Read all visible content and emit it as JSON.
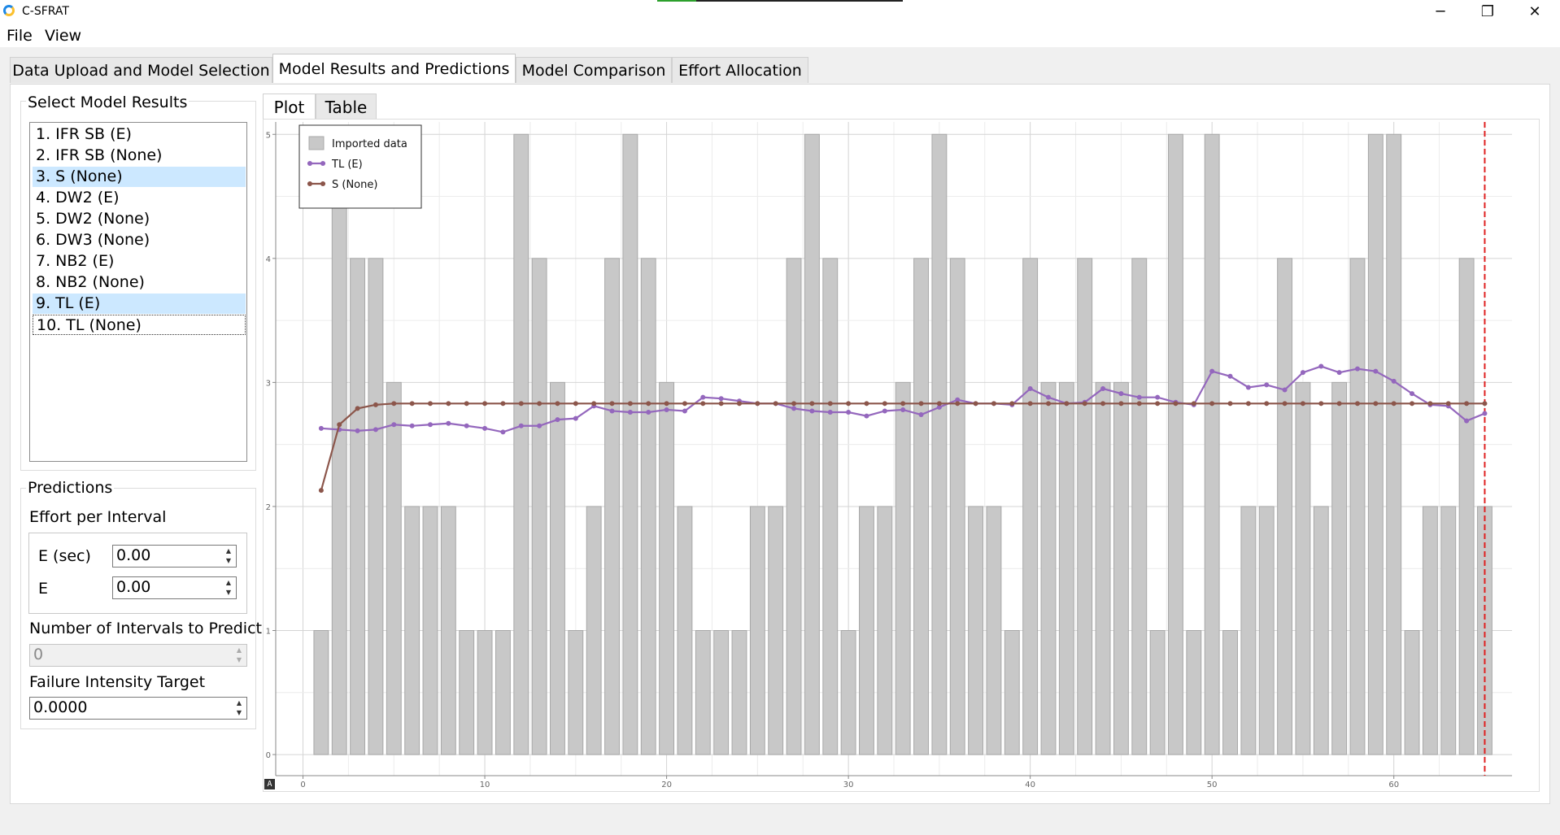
{
  "window": {
    "title": "C-SFRAT",
    "progress": 0.16,
    "controls": [
      "─",
      "❐",
      "✕"
    ]
  },
  "menu": [
    "File",
    "View"
  ],
  "main_tabs": [
    {
      "label": "Data Upload and Model Selection",
      "active": false
    },
    {
      "label": "Model Results and Predictions",
      "active": true
    },
    {
      "label": "Model Comparison",
      "active": false
    },
    {
      "label": "Effort Allocation",
      "active": false
    }
  ],
  "model_results": {
    "title": "Select Model Results",
    "items": [
      {
        "label": "1. IFR SB (E)",
        "selected": false,
        "focused": false
      },
      {
        "label": "2. IFR SB (None)",
        "selected": false,
        "focused": false
      },
      {
        "label": "3. S (None)",
        "selected": true,
        "focused": false
      },
      {
        "label": "4. DW2 (E)",
        "selected": false,
        "focused": false
      },
      {
        "label": "5. DW2 (None)",
        "selected": false,
        "focused": false
      },
      {
        "label": "6. DW3 (None)",
        "selected": false,
        "focused": false
      },
      {
        "label": "7. NB2 (E)",
        "selected": false,
        "focused": false
      },
      {
        "label": "8. NB2 (None)",
        "selected": false,
        "focused": false
      },
      {
        "label": "9. TL (E)",
        "selected": true,
        "focused": false
      },
      {
        "label": "10. TL (None)",
        "selected": false,
        "focused": true
      }
    ]
  },
  "predictions": {
    "title": "Predictions",
    "effort_label": "Effort per Interval",
    "effort_fields": [
      {
        "label": "E (sec)",
        "value": "0.00"
      },
      {
        "label": "E",
        "value": "0.00"
      }
    ],
    "intervals_label": "Number of Intervals to Predict",
    "intervals_value": "0",
    "target_label": "Failure Intensity Target",
    "target_value": "0.0000"
  },
  "plot_tabs": [
    {
      "label": "Plot",
      "active": true
    },
    {
      "label": "Table",
      "active": false
    }
  ],
  "chart_data": {
    "type": "bar",
    "x": [
      1,
      2,
      3,
      4,
      5,
      6,
      7,
      8,
      9,
      10,
      11,
      12,
      13,
      14,
      15,
      16,
      17,
      18,
      19,
      20,
      21,
      22,
      23,
      24,
      25,
      26,
      27,
      28,
      29,
      30,
      31,
      32,
      33,
      34,
      35,
      36,
      37,
      38,
      39,
      40,
      41,
      42,
      43,
      44,
      45,
      46,
      47,
      48,
      49,
      50,
      51,
      52,
      53,
      54,
      55,
      56,
      57,
      58,
      59,
      60,
      61,
      62,
      63,
      64,
      65
    ],
    "values": [
      1,
      5,
      4,
      4,
      3,
      2,
      2,
      2,
      1,
      1,
      1,
      5,
      4,
      3,
      1,
      2,
      4,
      5,
      4,
      3,
      2,
      1,
      1,
      1,
      2,
      2,
      4,
      5,
      4,
      1,
      2,
      2,
      3,
      4,
      5,
      4,
      2,
      2,
      1,
      4,
      3,
      3,
      4,
      3,
      3,
      4,
      1,
      5,
      1,
      5,
      1,
      2,
      2,
      4,
      3,
      2,
      3,
      4,
      5,
      5,
      1,
      2,
      2,
      4,
      2
    ],
    "series": [
      {
        "name": "Imported data",
        "kind": "bar",
        "color": "#c8c8c8"
      },
      {
        "name": "TL (E)",
        "kind": "line",
        "color": "#9467bd",
        "values": [
          2.63,
          2.62,
          2.61,
          2.62,
          2.66,
          2.65,
          2.66,
          2.67,
          2.65,
          2.63,
          2.6,
          2.65,
          2.65,
          2.7,
          2.71,
          2.81,
          2.77,
          2.76,
          2.76,
          2.78,
          2.77,
          2.88,
          2.87,
          2.85,
          2.83,
          2.83,
          2.79,
          2.77,
          2.76,
          2.76,
          2.73,
          2.77,
          2.78,
          2.74,
          2.8,
          2.86,
          2.83,
          2.83,
          2.82,
          2.95,
          2.88,
          2.83,
          2.84,
          2.95,
          2.91,
          2.88,
          2.88,
          2.84,
          2.82,
          3.09,
          3.05,
          2.96,
          2.98,
          2.94,
          3.08,
          3.13,
          3.08,
          3.11,
          3.09,
          3.01,
          2.91,
          2.82,
          2.81,
          2.69,
          2.75
        ]
      },
      {
        "name": "S (None)",
        "kind": "line",
        "color": "#8c564b",
        "values": [
          2.13,
          2.66,
          2.79,
          2.82,
          2.83,
          2.83,
          2.83,
          2.83,
          2.83,
          2.83,
          2.83,
          2.83,
          2.83,
          2.83,
          2.83,
          2.83,
          2.83,
          2.83,
          2.83,
          2.83,
          2.83,
          2.83,
          2.83,
          2.83,
          2.83,
          2.83,
          2.83,
          2.83,
          2.83,
          2.83,
          2.83,
          2.83,
          2.83,
          2.83,
          2.83,
          2.83,
          2.83,
          2.83,
          2.83,
          2.83,
          2.83,
          2.83,
          2.83,
          2.83,
          2.83,
          2.83,
          2.83,
          2.83,
          2.83,
          2.83,
          2.83,
          2.83,
          2.83,
          2.83,
          2.83,
          2.83,
          2.83,
          2.83,
          2.83,
          2.83,
          2.83,
          2.83,
          2.83,
          2.83,
          2.83
        ]
      }
    ],
    "xlim": [
      -1.5,
      66.5
    ],
    "ylim": [
      -0.17,
      5.1
    ],
    "xticks": [
      0,
      10,
      20,
      30,
      40,
      50,
      60
    ],
    "yticks": [
      0,
      1,
      2,
      3,
      4,
      5
    ],
    "vline": {
      "x": 65,
      "color": "#e02020",
      "style": "dashed"
    },
    "grid": true,
    "legend": "top-left"
  },
  "corner_label": "A"
}
